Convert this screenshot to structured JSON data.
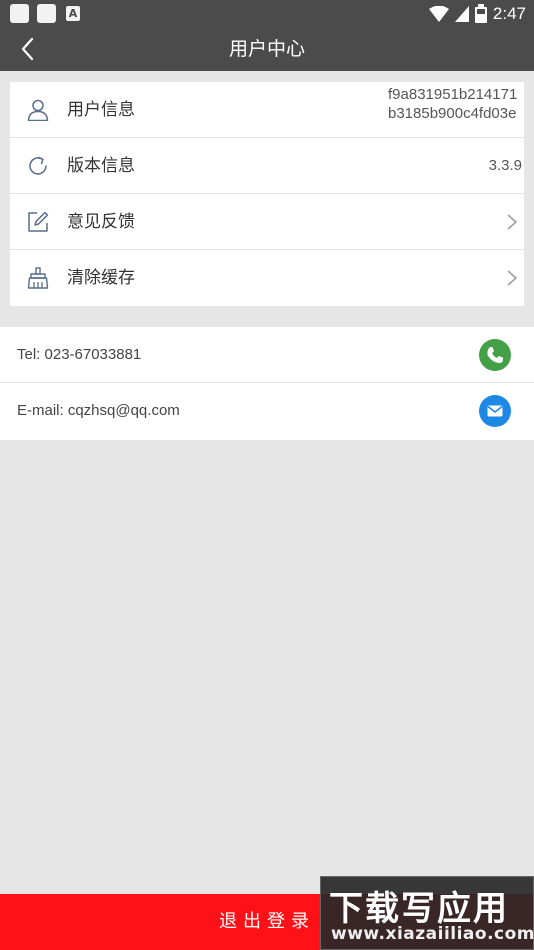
{
  "status_bar": {
    "time": "2:47",
    "notif_letter": "A"
  },
  "header": {
    "title": "用户中心"
  },
  "menu": [
    {
      "id": "user-info",
      "label": "用户信息",
      "value": "f9a831951b214171b3185b900c4fd03e"
    },
    {
      "id": "version-info",
      "label": "版本信息",
      "value": "3.3.9"
    },
    {
      "id": "feedback",
      "label": "意见反馈"
    },
    {
      "id": "clear-cache",
      "label": "清除缓存"
    }
  ],
  "contact": {
    "tel": "Tel: 023-67033881",
    "email": "E-mail: cqzhsq@qq.com"
  },
  "logout_label": "退出登录",
  "watermark": {
    "cn": "下载写应用",
    "url": "www.xiazaiiliao.com"
  },
  "colors": {
    "header": "#4b4b4b",
    "logout": "#ff1117",
    "phone": "#43a047",
    "mail": "#1e88e5"
  },
  "icons": [
    "back-arrow-icon",
    "user-icon",
    "refresh-icon",
    "edit-icon",
    "broom-icon",
    "chevron-right-icon",
    "phone-icon",
    "mail-icon"
  ]
}
